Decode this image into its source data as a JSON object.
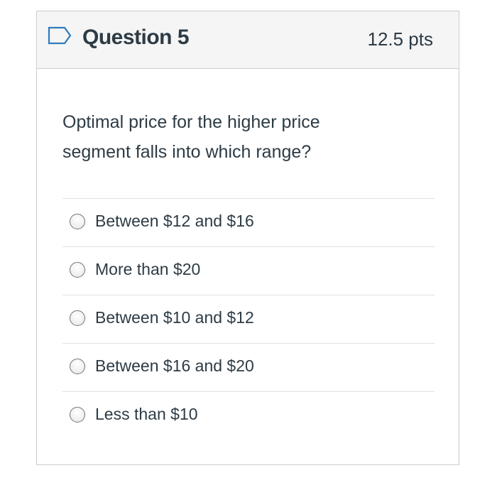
{
  "question": {
    "title": "Question 5",
    "points": "12.5 pts",
    "text": "Optimal price for the higher price segment falls into which range?",
    "flag_icon": "flag-icon",
    "answers": [
      {
        "label": "Between $12 and $16",
        "selected": false
      },
      {
        "label": "More than $20",
        "selected": false
      },
      {
        "label": "Between $10 and $12",
        "selected": false
      },
      {
        "label": "Between $16 and $20",
        "selected": false
      },
      {
        "label": "Less than $10",
        "selected": false
      }
    ]
  },
  "colors": {
    "text": "#2d3b45",
    "border": "#c7cdd1",
    "header_bg": "#f5f5f5",
    "flag": "#2d7bbf"
  }
}
